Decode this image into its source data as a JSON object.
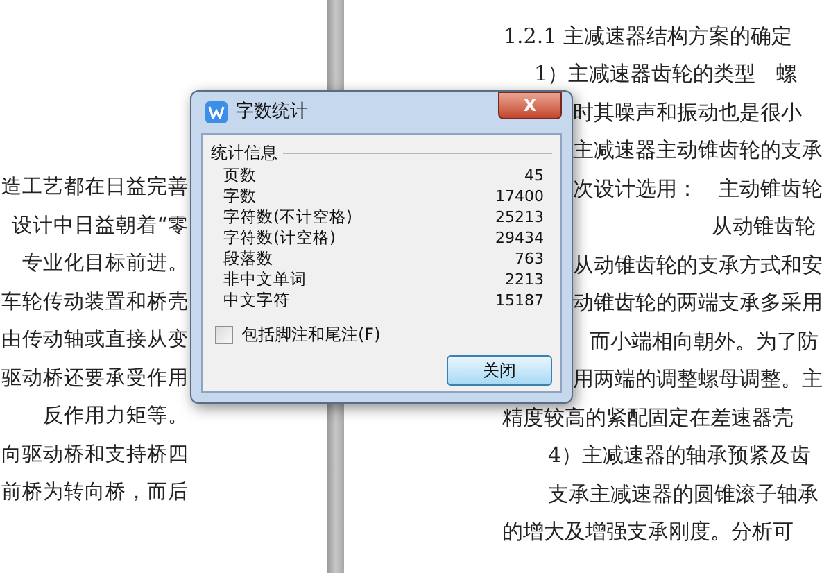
{
  "left_page": {
    "lines": [
      "造工艺都在日益完善",
      "设计中日益朝着“零",
      "专业化目标前进。",
      "车轮传动装置和桥壳",
      "由传动轴或直接从变",
      "驱动桥还要承受作用",
      "反作用力矩等。",
      "向驱动桥和支持桥四",
      "前桥为转向桥，而后"
    ]
  },
  "right_page": {
    "heading": "1.2.1 主减速器结构方案的确定",
    "lines": [
      "1）主减速器齿轮的类型　螺",
      "时其噪声和振动也是很小",
      "主减速器主动锥齿轮的支承",
      "次设计选用：　主动锥齿轮",
      "从动锥齿轮",
      "从动锥齿轮的支承方式和安",
      "动锥齿轮的两端支承多采用",
      "而小端相向朝外。为了防",
      "用两端的调整螺母调整。主",
      "精度较高的紧配固定在差速器壳",
      "4）主减速器的轴承预紧及齿",
      "支承主减速器的圆锥滚子轴承",
      "的增大及增强支承刚度。分析可"
    ]
  },
  "dialog": {
    "title": "字数统计",
    "close_glyph": "X",
    "group_title": "统计信息",
    "stats": [
      {
        "label": "页数",
        "value": "45"
      },
      {
        "label": "字数",
        "value": "17400"
      },
      {
        "label": "字符数(不计空格)",
        "value": "25213"
      },
      {
        "label": "字符数(计空格)",
        "value": "29434"
      },
      {
        "label": "段落数",
        "value": "763"
      },
      {
        "label": "非中文单词",
        "value": "2213"
      },
      {
        "label": "中文字符",
        "value": "15187"
      }
    ],
    "checkbox": {
      "label": "包括脚注和尾注(F)",
      "checked": false
    },
    "button": "关闭"
  }
}
